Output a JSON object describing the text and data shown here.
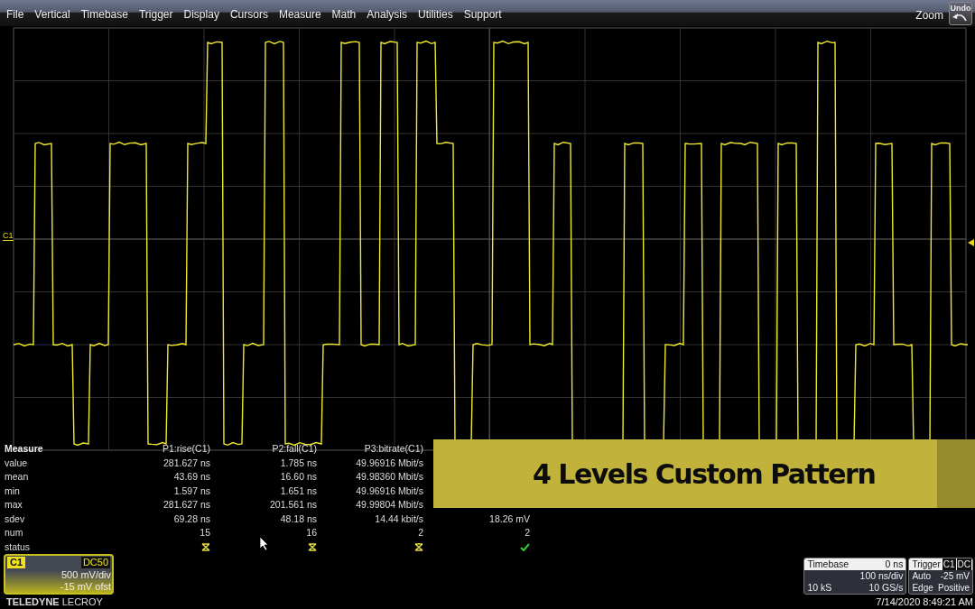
{
  "menu": {
    "items": [
      "File",
      "Vertical",
      "Timebase",
      "Trigger",
      "Display",
      "Cursors",
      "Measure",
      "Math",
      "Analysis",
      "Utilities",
      "Support"
    ],
    "zoom": "Zoom",
    "undo": "Undo"
  },
  "trace": {
    "label": "C1"
  },
  "measure": {
    "title": "Measure",
    "row_labels": [
      "value",
      "mean",
      "min",
      "max",
      "sdev",
      "num",
      "status"
    ],
    "columns": [
      {
        "header": "P1:rise(C1)",
        "value": "281.627 ns",
        "mean": "43.69 ns",
        "min": "1.597 ns",
        "max": "281.627 ns",
        "sdev": "69.28 ns",
        "num": "15",
        "status": {
          "kind": "warning"
        }
      },
      {
        "header": "P2:fall(C1)",
        "value": "1.785 ns",
        "mean": "16.60 ns",
        "min": "1.651 ns",
        "max": "201.561 ns",
        "sdev": "48.18 ns",
        "num": "16",
        "status": {
          "kind": "warning"
        }
      },
      {
        "header": "P3:bitrate(C1)",
        "value": "49.96916 Mbit/s",
        "mean": "49.98360 Mbit/s",
        "min": "49.96916 Mbit/s",
        "max": "49.99804 Mbit/s",
        "sdev": "14.44 kbit/s",
        "num": "2",
        "status": {
          "kind": "warning"
        }
      },
      {
        "sdev": "18.26 mV",
        "num": "2",
        "status": {
          "kind": "pass"
        }
      }
    ]
  },
  "banner": {
    "text": "4 Levels Custom Pattern"
  },
  "channel": {
    "name": "C1",
    "coupling": "DC50",
    "scale": "500 mV/div",
    "offset": "-15 mV ofst"
  },
  "logo": {
    "brand": "TELEDYNE",
    "name": "LECROY"
  },
  "timebase": {
    "title": "Timebase",
    "delay": "0 ns",
    "scale": "100 ns/div",
    "samples": "10 kS",
    "rate": "10 GS/s"
  },
  "trigger": {
    "title": "Trigger",
    "source": "C1",
    "coupling": "DC",
    "mode": "Auto",
    "level": "-25 mV",
    "type": "Edge",
    "slope": "Positive"
  },
  "datetime": "7/14/2020 8:49:21 AM"
}
